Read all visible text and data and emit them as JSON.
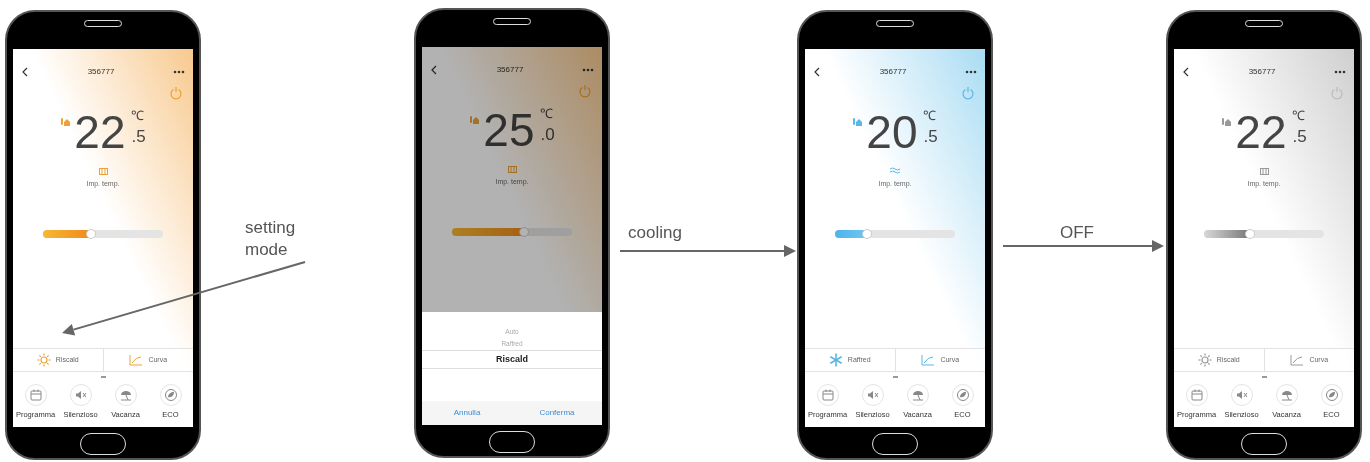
{
  "phones": [
    {
      "on": true,
      "title": "356777",
      "temp_whole": "22",
      "temp_decimal": ".5",
      "unit": "℃",
      "set_label": "Imp. temp.",
      "level": 0.4,
      "mode": {
        "kind": "heat",
        "label": "Riscald"
      },
      "curve_label": "Curva",
      "shortcuts": [
        "Programma",
        "Silenzioso",
        "Vacanza",
        "ECO"
      ]
    },
    {
      "on": true,
      "title": "356777",
      "temp_whole": "25",
      "temp_decimal": ".0",
      "unit": "℃",
      "set_label": "Imp. temp.",
      "level": 0.6,
      "mode": {
        "kind": "heat"
      },
      "picker": {
        "options": [
          {
            "label": "Auto",
            "selected": false
          },
          {
            "label": "Raffred",
            "selected": false
          },
          {
            "label": "Riscald",
            "selected": true
          }
        ],
        "cancel": "Annulla",
        "confirm": "Conferma"
      }
    },
    {
      "on": true,
      "title": "356777",
      "temp_whole": "20",
      "temp_decimal": ".5",
      "unit": "℃",
      "set_label": "Imp. temp.",
      "level": 0.27,
      "mode": {
        "kind": "cool",
        "label": "Raffred"
      },
      "curve_label": "Curva",
      "shortcuts": [
        "Programma",
        "Silenzioso",
        "Vacanza",
        "ECO"
      ]
    },
    {
      "on": false,
      "title": "356777",
      "temp_whole": "22",
      "temp_decimal": ".5",
      "unit": "℃",
      "set_label": "Imp. temp.",
      "level": 0.38,
      "mode": {
        "kind": "heat",
        "label": "Riscald"
      },
      "curve_label": "Curva",
      "shortcuts": [
        "Programma",
        "Silenzioso",
        "Vacanza",
        "ECO"
      ]
    }
  ],
  "annotations": [
    "setting mode",
    "cooling",
    "OFF"
  ]
}
